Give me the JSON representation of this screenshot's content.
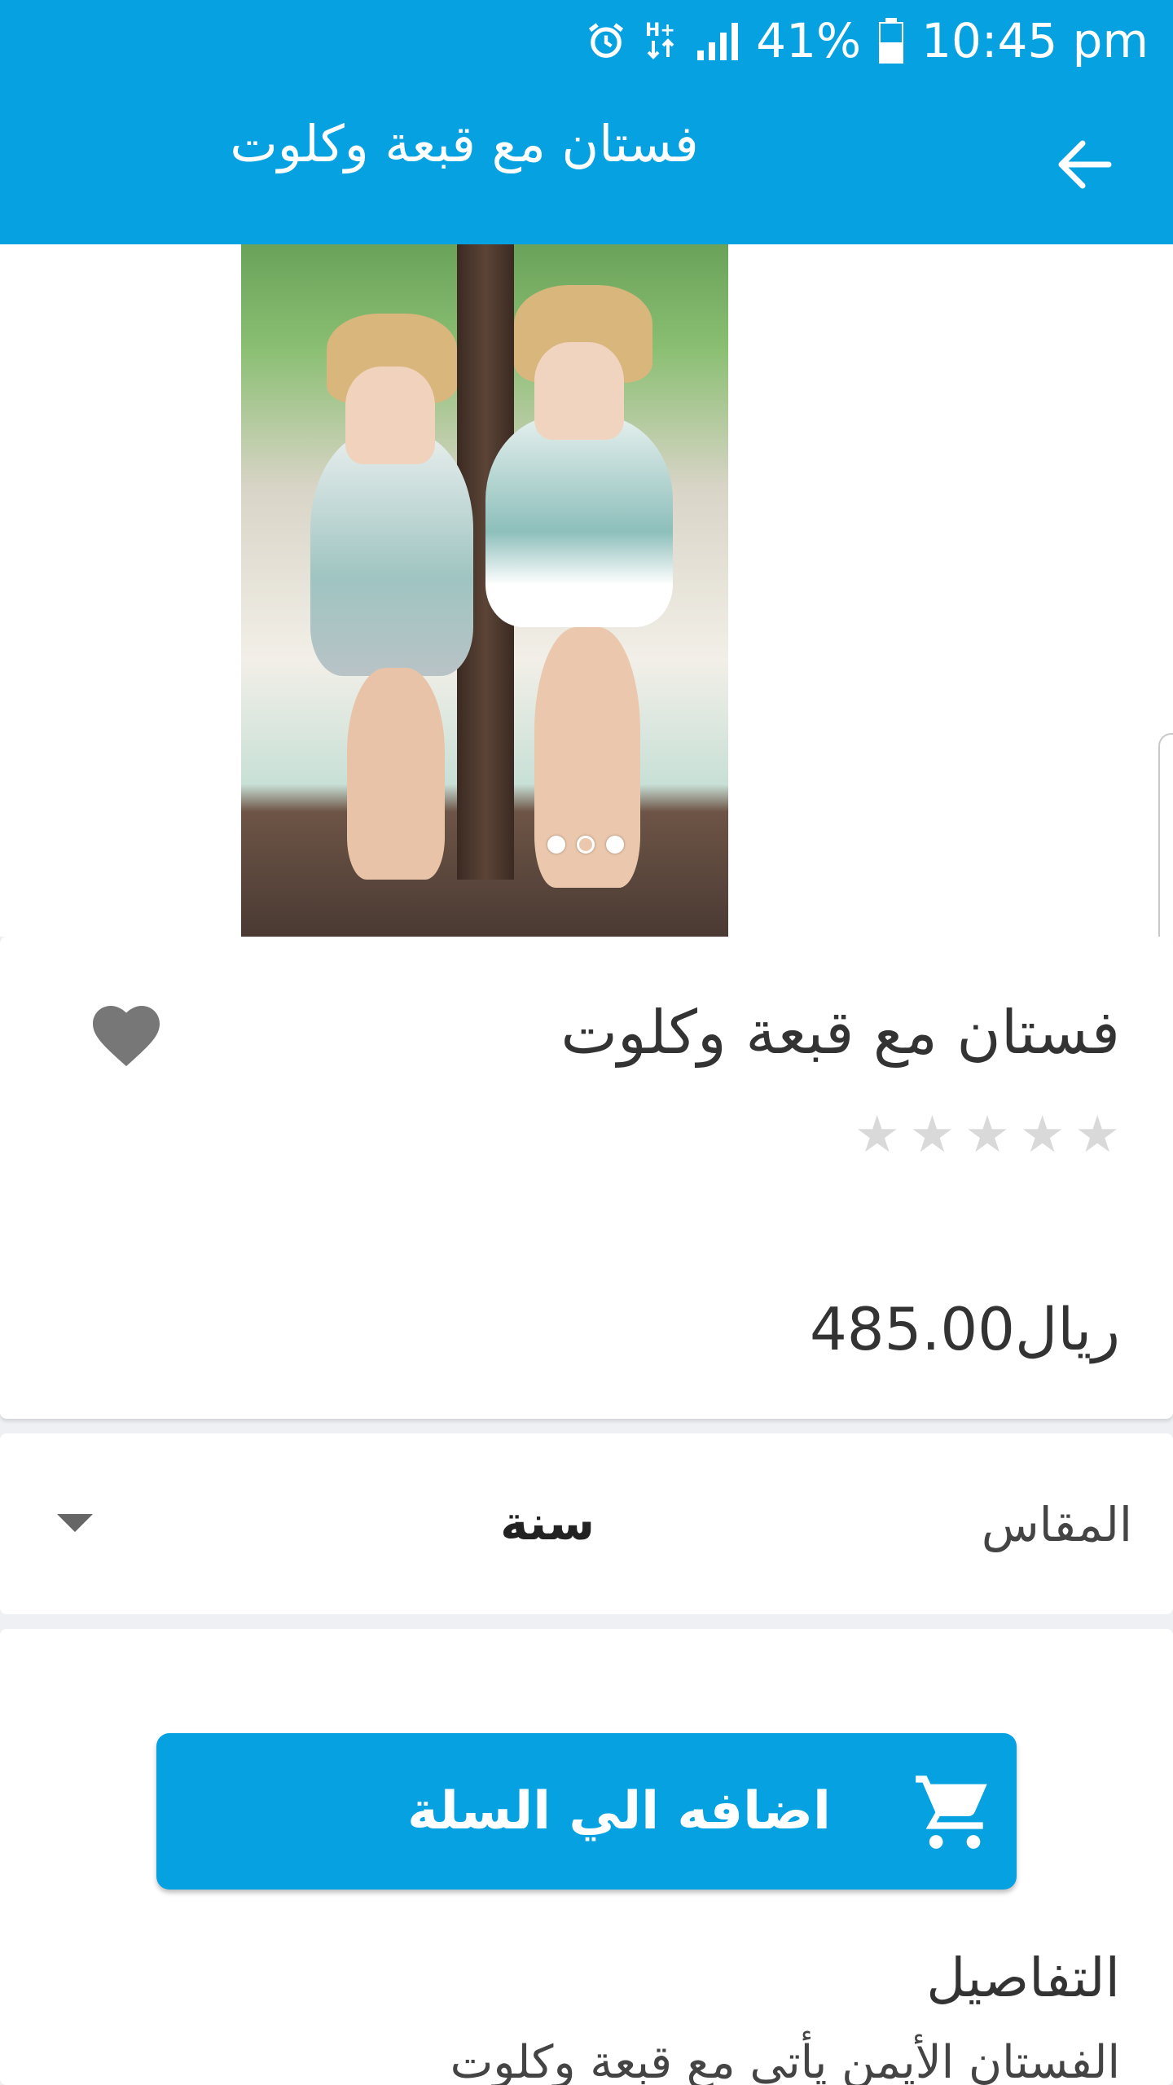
{
  "status_bar": {
    "battery_percent": "41%",
    "time": "10:45 pm",
    "network": "H+",
    "icons": [
      "alarm-icon",
      "hplus-icon",
      "signal-icon",
      "battery-icon"
    ]
  },
  "app_bar": {
    "title": "فستان مع قبعة وكلوت",
    "back_icon": "arrow-back-icon"
  },
  "gallery": {
    "page_count": 3,
    "active_index": 1
  },
  "product": {
    "title": "فستان مع قبعة وكلوت",
    "rating": 0,
    "max_rating": 5,
    "price": "485.00ريال"
  },
  "options": {
    "size_label": "المقاس",
    "size_value": "سنة"
  },
  "actions": {
    "add_to_cart": "اضافه الي السلة"
  },
  "details": {
    "heading": "التفاصيل",
    "text": "الفستان الأيمن يأتي مع قبعة وكلوت"
  },
  "colors": {
    "primary": "#06a1e1",
    "star_empty": "#d9d9d9",
    "heart": "#777777"
  }
}
